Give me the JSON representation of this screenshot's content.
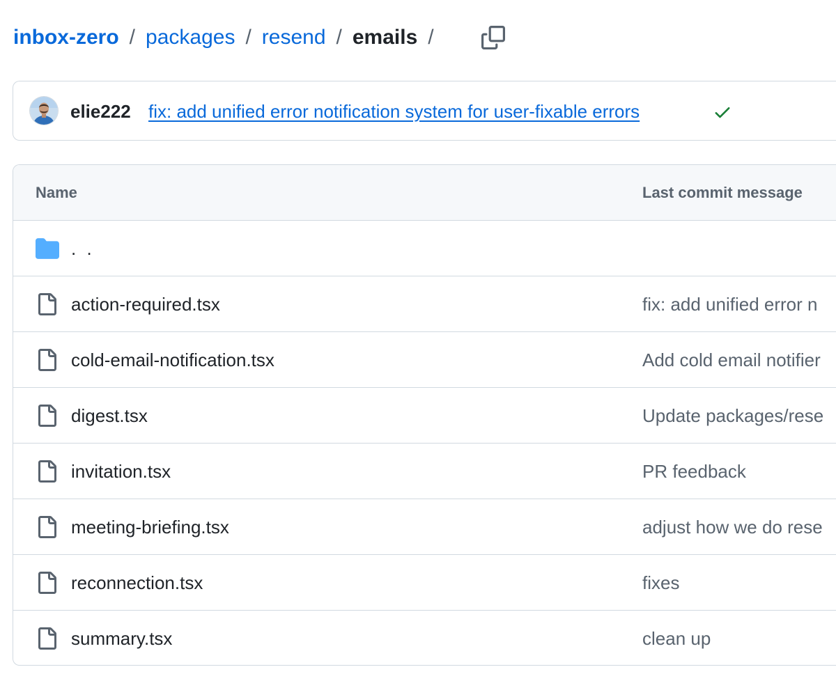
{
  "breadcrumb": {
    "items": [
      {
        "label": "inbox-zero"
      },
      {
        "label": "packages"
      },
      {
        "label": "resend"
      }
    ],
    "separator": "/",
    "current": "emails",
    "trailing_separator": "/"
  },
  "latest_commit": {
    "author": "elie222",
    "message": "fix: add unified error notification system for user-fixable errors",
    "status": "success"
  },
  "table": {
    "headers": {
      "name": "Name",
      "last_commit_message": "Last commit message"
    },
    "parent_row": {
      "label": ". ."
    },
    "rows": [
      {
        "name": "action-required.tsx",
        "commit": "fix: add unified error n"
      },
      {
        "name": "cold-email-notification.tsx",
        "commit": "Add cold email notifier"
      },
      {
        "name": "digest.tsx",
        "commit": "Update packages/rese"
      },
      {
        "name": "invitation.tsx",
        "commit": "PR feedback"
      },
      {
        "name": "meeting-briefing.tsx",
        "commit": "adjust how we do rese"
      },
      {
        "name": "reconnection.tsx",
        "commit": "fixes"
      },
      {
        "name": "summary.tsx",
        "commit": "clean up"
      }
    ]
  },
  "icons": {
    "copy": "copy-icon",
    "check": "check-icon",
    "folder": "folder-icon",
    "file": "file-icon"
  },
  "colors": {
    "link": "#0969da",
    "text": "#1f2328",
    "muted": "#59636e",
    "border": "#d1d9e0",
    "header_bg": "#f6f8fa",
    "success": "#1a7f37",
    "folder": "#54aeff"
  }
}
